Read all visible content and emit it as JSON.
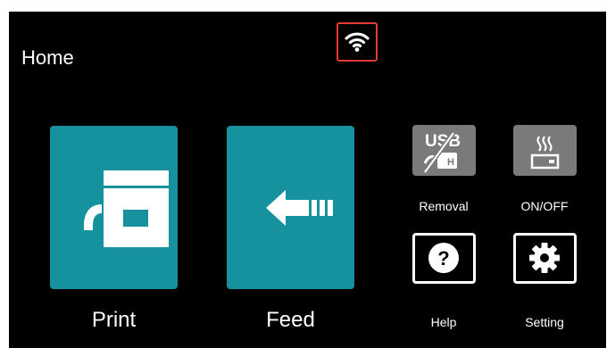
{
  "header": {
    "title": "Home",
    "wifi_icon": "wifi-icon",
    "highlight_color": "#e53935"
  },
  "main": {
    "print_label": "Print",
    "feed_label": "Feed",
    "removal_label": "Removal",
    "onoff_label": "ON/OFF",
    "help_label": "Help",
    "setting_label": "Setting",
    "usb_text": "USB",
    "usb_connector_letter": "H",
    "help_glyph": "?"
  },
  "colors": {
    "tile": "#15929e",
    "gray_tile": "#7a7a7a",
    "background": "#000000",
    "text": "#ffffff"
  }
}
